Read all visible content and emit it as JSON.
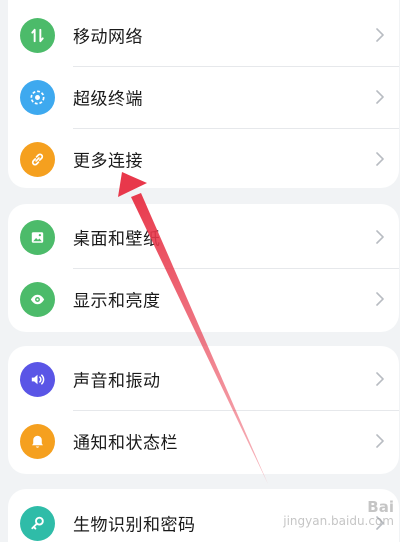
{
  "colors": {
    "mobile_network": "#4cbb6a",
    "super_terminal": "#3ea9ef",
    "more_connections": "#f5a01f",
    "desktop_wallpaper": "#4cbb6a",
    "display_brightness": "#4cbb6a",
    "sound_vibration": "#5a55e6",
    "notification_status_bar": "#f5a01f",
    "biometrics_password": "#2fbca8",
    "annotation_arrow": "#e8384b"
  },
  "settings": {
    "groups": [
      {
        "items": [
          {
            "label": "移动网络",
            "icon": "mobile-data-icon"
          },
          {
            "label": "超级终端",
            "icon": "super-device-icon"
          },
          {
            "label": "更多连接",
            "icon": "link-icon"
          }
        ]
      },
      {
        "items": [
          {
            "label": "桌面和壁纸",
            "icon": "wallpaper-icon"
          },
          {
            "label": "显示和亮度",
            "icon": "eye-icon"
          }
        ]
      },
      {
        "items": [
          {
            "label": "声音和振动",
            "icon": "speaker-icon"
          },
          {
            "label": "通知和状态栏",
            "icon": "bell-icon"
          }
        ]
      },
      {
        "items": [
          {
            "label": "生物识别和密码",
            "icon": "key-icon"
          }
        ]
      }
    ]
  },
  "watermark": {
    "brand": "Bai",
    "url": "jingyan.baidu.com"
  }
}
